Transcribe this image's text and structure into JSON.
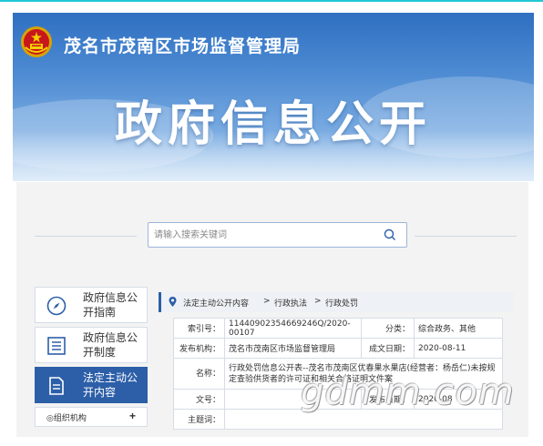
{
  "header": {
    "agency_name": "茂名市茂南区市场监督管理局",
    "big_title": "政府信息公开"
  },
  "search": {
    "placeholder": "请输入搜索关键词",
    "icon": "search-icon"
  },
  "sidebar": {
    "items": [
      {
        "label": "政府信息公开指南",
        "icon": "compass-icon",
        "active": false
      },
      {
        "label": "政府信息公开制度",
        "icon": "list-icon",
        "active": false
      },
      {
        "label": "法定主动公开内容",
        "icon": "document-icon",
        "active": true
      }
    ],
    "sub_item": {
      "label": "◎组织机构",
      "expand": "+"
    }
  },
  "breadcrumb": {
    "items": [
      "法定主动公开内容",
      "行政执法",
      "行政处罚"
    ],
    "separator": ">"
  },
  "info": {
    "index_label": "索引号：",
    "index_value": "11440902354669246Q/2020-00107",
    "category_label": "分类：",
    "category_value": "综合政务、其他",
    "publisher_label": "发布机构：",
    "publisher_value": "茂名市茂南区市场监督管理局",
    "date_label": "成文日期：",
    "date_value": "2020-08-11",
    "name_label": "名称：",
    "name_value": "行政处罚信息公开表--茂名市茂南区优春果水果店(经营者：杨岳仁)未按规定查验供货者的许可证和相关合格证明文件案",
    "doc_no_label": "文号：",
    "doc_no_value": "",
    "publish_date_label": "发布日期：",
    "publish_date_value": "2020-08",
    "subject_label": "主题词：",
    "subject_value": ""
  },
  "watermark": "gdmm.com",
  "colors": {
    "accent": "#2d5fa8",
    "banner_top": "#2f6fc1",
    "topline": "#1ec8d3"
  }
}
